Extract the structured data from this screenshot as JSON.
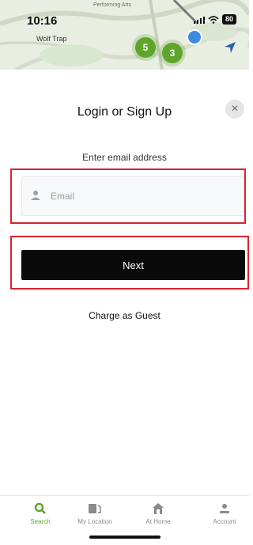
{
  "status_bar": {
    "time": "10:16",
    "battery": "80"
  },
  "map": {
    "label_top": "Performing Arts",
    "place_label": "Wolf Trap",
    "clusters": [
      "5",
      "3"
    ],
    "cluster_color": "#5fa52b",
    "user_dot_color": "#3f8ae0"
  },
  "modal": {
    "title": "Login or Sign Up",
    "close_symbol": "×",
    "field_label": "Enter email address",
    "email_placeholder": "Email",
    "next_label": "Next",
    "guest_label": "Charge as Guest",
    "highlight_color": "#d9232f"
  },
  "tabs": [
    {
      "label": "Search",
      "icon": "search-icon",
      "active": true
    },
    {
      "label": "My Location",
      "icon": "location-icon",
      "active": false
    },
    {
      "label": "At Home",
      "icon": "home-icon",
      "active": false
    },
    {
      "label": "Account",
      "icon": "account-icon",
      "active": false
    }
  ]
}
